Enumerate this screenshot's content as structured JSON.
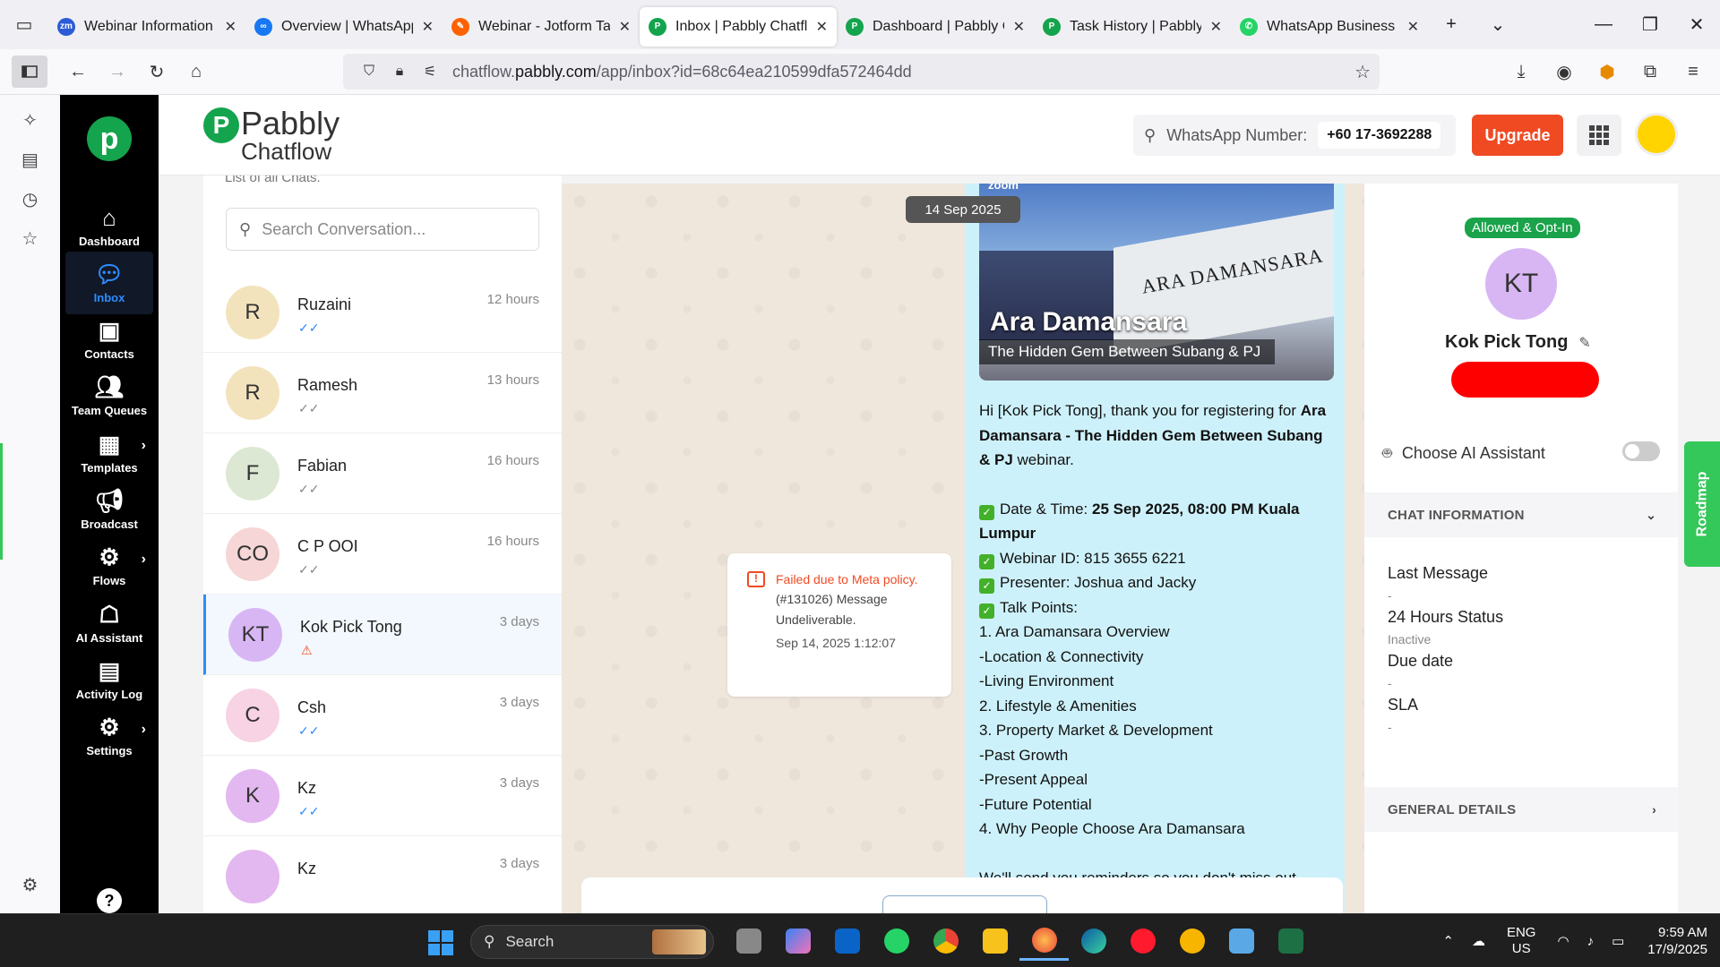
{
  "browser": {
    "tabs": [
      {
        "title": "Webinar Information -",
        "favicon_color": "#2d5bd6",
        "favicon_text": "zm"
      },
      {
        "title": "Overview | WhatsApp |",
        "favicon_color": "#1877f2",
        "favicon_text": "∞"
      },
      {
        "title": "Webinar - Jotform Tab",
        "favicon_color": "#ff6100",
        "favicon_text": "✎"
      },
      {
        "title": "Inbox | Pabbly Chatflo",
        "favicon_color": "#14a44d",
        "favicon_text": "P",
        "active": true
      },
      {
        "title": "Dashboard | Pabbly Co",
        "favicon_color": "#14a44d",
        "favicon_text": "P"
      },
      {
        "title": "Task History | Pabbly C",
        "favicon_color": "#14a44d",
        "favicon_text": "P"
      },
      {
        "title": "WhatsApp Business",
        "favicon_color": "#25d366",
        "favicon_text": "✆"
      }
    ],
    "url_prefix": "chatflow.",
    "url_domain": "pabbly.com",
    "url_path": "/app/inbox?id=68c64ea210599dfa572464dd"
  },
  "appnav": {
    "items": [
      {
        "label": "Dashboard",
        "icon": "home-icon"
      },
      {
        "label": "Inbox",
        "icon": "chat-icon",
        "active": true
      },
      {
        "label": "Contacts",
        "icon": "contact-icon"
      },
      {
        "label": "Team Queues",
        "icon": "team-icon"
      },
      {
        "label": "Templates",
        "icon": "template-icon",
        "chevron": true
      },
      {
        "label": "Broadcast",
        "icon": "megaphone-icon"
      },
      {
        "label": "Flows",
        "icon": "flow-icon",
        "chevron": true
      },
      {
        "label": "AI Assistant",
        "icon": "robot-icon"
      },
      {
        "label": "Activity Log",
        "icon": "log-icon"
      },
      {
        "label": "Settings",
        "icon": "gear-icon",
        "chevron": true
      }
    ],
    "help": "?"
  },
  "header": {
    "brand_line1": "Pabbly",
    "brand_line2": "Chatflow",
    "wa_label": "WhatsApp Number:",
    "wa_number": "+60 17-3692288",
    "upgrade": "Upgrade"
  },
  "conversations": {
    "subtitle": "List of all Chats.",
    "search_placeholder": "Search Conversation...",
    "items": [
      {
        "initials": "R",
        "name": "Ruzaini",
        "time": "12 hours",
        "status": "✓✓",
        "status_type": "read",
        "color": "#f3e3bd"
      },
      {
        "initials": "R",
        "name": "Ramesh",
        "time": "13 hours",
        "status": "✓✓",
        "status_type": "grey",
        "color": "#f3e3bd"
      },
      {
        "initials": "F",
        "name": "Fabian",
        "time": "16 hours",
        "status": "✓✓",
        "status_type": "grey",
        "color": "#dde8d4"
      },
      {
        "initials": "CO",
        "name": "C P OOI",
        "time": "16 hours",
        "status": "✓✓",
        "status_type": "grey",
        "color": "#f6d6d6"
      },
      {
        "initials": "KT",
        "name": "Kok Pick Tong",
        "time": "3 days",
        "status": "⚠",
        "status_type": "err",
        "color": "#d8b6f4",
        "selected": true
      },
      {
        "initials": "C",
        "name": "Csh",
        "time": "3 days",
        "status": "✓✓",
        "status_type": "read",
        "color": "#f7d3e4"
      },
      {
        "initials": "K",
        "name": "Kz",
        "time": "3 days",
        "status": "✓✓",
        "status_type": "read",
        "color": "#e3b7f0"
      },
      {
        "initials": "",
        "name": "Kz",
        "time": "3 days",
        "status": "",
        "status_type": "grey",
        "color": "#e3b7f0"
      }
    ]
  },
  "chat": {
    "date_pill": "14 Sep 2025",
    "failed": {
      "title": "Failed due to Meta policy.",
      "message": "(#131026) Message Undeliverable.",
      "date": "Sep 14, 2025 1:12:07"
    },
    "image": {
      "zoom_label": "zoom",
      "wall_text": "ARA DAMANSARA",
      "title": "Ara Damansara",
      "subtitle": "The Hidden Gem Between Subang & PJ"
    },
    "message": {
      "greeting": "Hi [Kok Pick Tong], thank you for registering for",
      "webinar_bold": "Ara Damansara - The Hidden Gem Between Subang & PJ",
      "webinar_suffix": " webinar.",
      "datetime_label": "Date & Time: ",
      "datetime_value": "25 Sep 2025, 08:00 PM Kuala Lumpur",
      "webinar_id": "Webinar ID: 815 3655 6221",
      "presenter": "Presenter: Joshua and Jacky",
      "talk_points": "Talk Points:",
      "points": [
        "1. Ara Damansara Overview",
        "-Location & Connectivity",
        "-Living Environment",
        "2. Lifestyle & Amenities",
        "3. Property Market & Development",
        "-Past Growth",
        "-Present Appeal",
        "-Future Potential",
        "4. Why People Choose Ara Damansara"
      ],
      "closing": "We'll send you reminders so you don't miss out"
    }
  },
  "contact": {
    "badge": "Allowed & Opt-In",
    "initials": "KT",
    "name": "Kok Pick Tong",
    "ai_label": "Choose AI Assistant",
    "chat_info_header": "CHAT INFORMATION",
    "fields": [
      {
        "label": "Last Message",
        "value": "-"
      },
      {
        "label": "24 Hours Status",
        "value": "Inactive"
      },
      {
        "label": "Due date",
        "value": "-"
      },
      {
        "label": "SLA",
        "value": "-"
      }
    ],
    "general_header": "GENERAL DETAILS",
    "roadmap": "Roadmap"
  },
  "taskbar": {
    "search": "Search",
    "lang1": "ENG",
    "lang2": "US",
    "time": "9:59 AM",
    "date": "17/9/2025"
  }
}
